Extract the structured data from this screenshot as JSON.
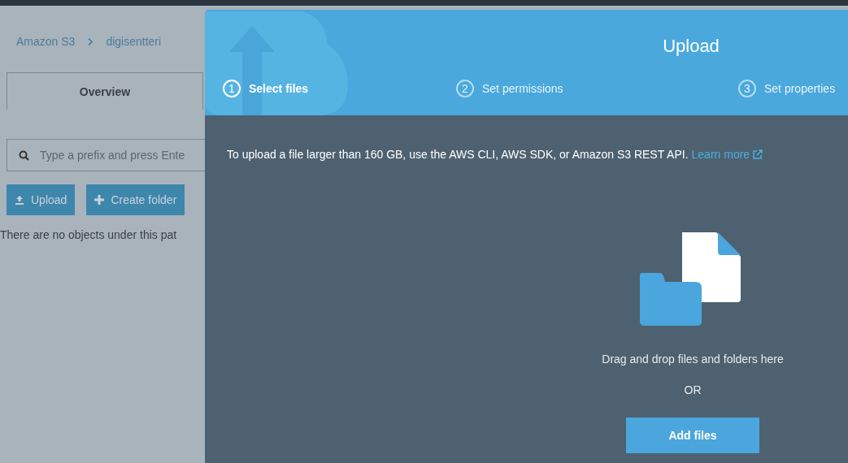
{
  "breadcrumb": [
    "Amazon S3",
    "digisentteri"
  ],
  "tabs": [
    {
      "label": "Overview",
      "selected": true
    }
  ],
  "search": {
    "placeholder": "Type a prefix and press Ente"
  },
  "actions": [
    {
      "kind": "upload",
      "label": "Upload"
    },
    {
      "kind": "create",
      "label": "Create folder"
    }
  ],
  "empty_message": "There are no objects under this pat",
  "dialog": {
    "title": "Upload",
    "steps": [
      {
        "number": "1",
        "label": "Select files",
        "selected": true
      },
      {
        "number": "2",
        "label": "Set permissions",
        "selected": false
      },
      {
        "number": "3",
        "label": "Set properties",
        "selected": false
      }
    ],
    "notice": "To upload a file larger than 160 GB, use the AWS CLI, AWS SDK, or Amazon S3 REST API.",
    "notice_link": "Learn more",
    "drop_text": "Drag and drop files and folders here",
    "or_text": "OR",
    "add_button": "Add files"
  }
}
